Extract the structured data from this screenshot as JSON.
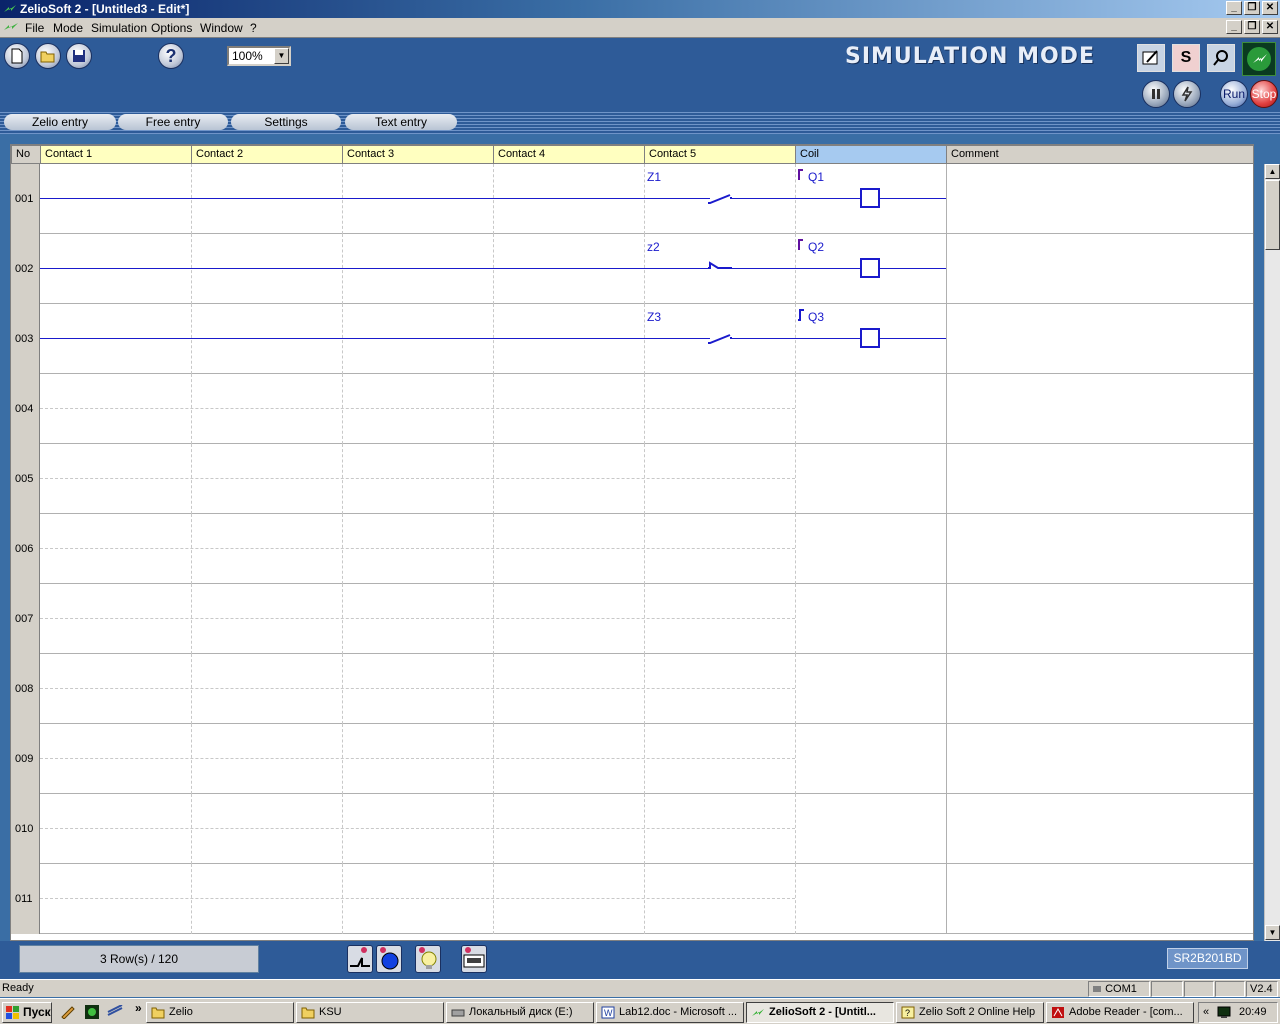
{
  "window": {
    "title": "ZelioSoft 2 - [Untitled3 - Edit*]"
  },
  "menu": [
    "File",
    "Mode",
    "Simulation",
    "Options",
    "Window",
    "?"
  ],
  "toolbar": {
    "zoom": "100%",
    "help_label": "?",
    "mode_banner": "SIMULATION MODE",
    "s_label": "S",
    "run_label": "Run",
    "stop_label": "Stop"
  },
  "tabs": [
    "Zelio entry",
    "Free entry",
    "Settings",
    "Text entry"
  ],
  "grid": {
    "headers": {
      "no": "No",
      "c1": "Contact 1",
      "c2": "Contact 2",
      "c3": "Contact 3",
      "c4": "Contact 4",
      "c5": "Contact 5",
      "coil": "Coil",
      "comment": "Comment"
    },
    "rows": [
      "001",
      "002",
      "003",
      "004",
      "005",
      "006",
      "007",
      "008",
      "009",
      "010",
      "011"
    ],
    "rungs": [
      {
        "contact": "Z1",
        "coil": "Q1"
      },
      {
        "contact": "z2",
        "coil": "Q2"
      },
      {
        "contact": "Z3",
        "coil": "Q3"
      }
    ]
  },
  "bottom": {
    "row_count": "3 Row(s) / 120",
    "model": "SR2B201BD"
  },
  "status": {
    "text": "Ready",
    "port": "COM1",
    "version": "V2.4"
  },
  "taskbar": {
    "start": "Пуск",
    "items": [
      "Zelio",
      "KSU",
      "Локальный диск (E:)",
      "Lab12.doc - Microsoft ...",
      "ZelioSoft 2 - [Untitl...",
      "Zelio Soft 2 Online Help",
      "Adobe Reader - [com..."
    ],
    "chevron": "«",
    "clock": "20:49"
  },
  "colors": {
    "rung": "#1a1acc",
    "header_contact": "#ffffc0",
    "header_coil": "#a6caf0",
    "toolbar_bg": "#2e5b98"
  }
}
